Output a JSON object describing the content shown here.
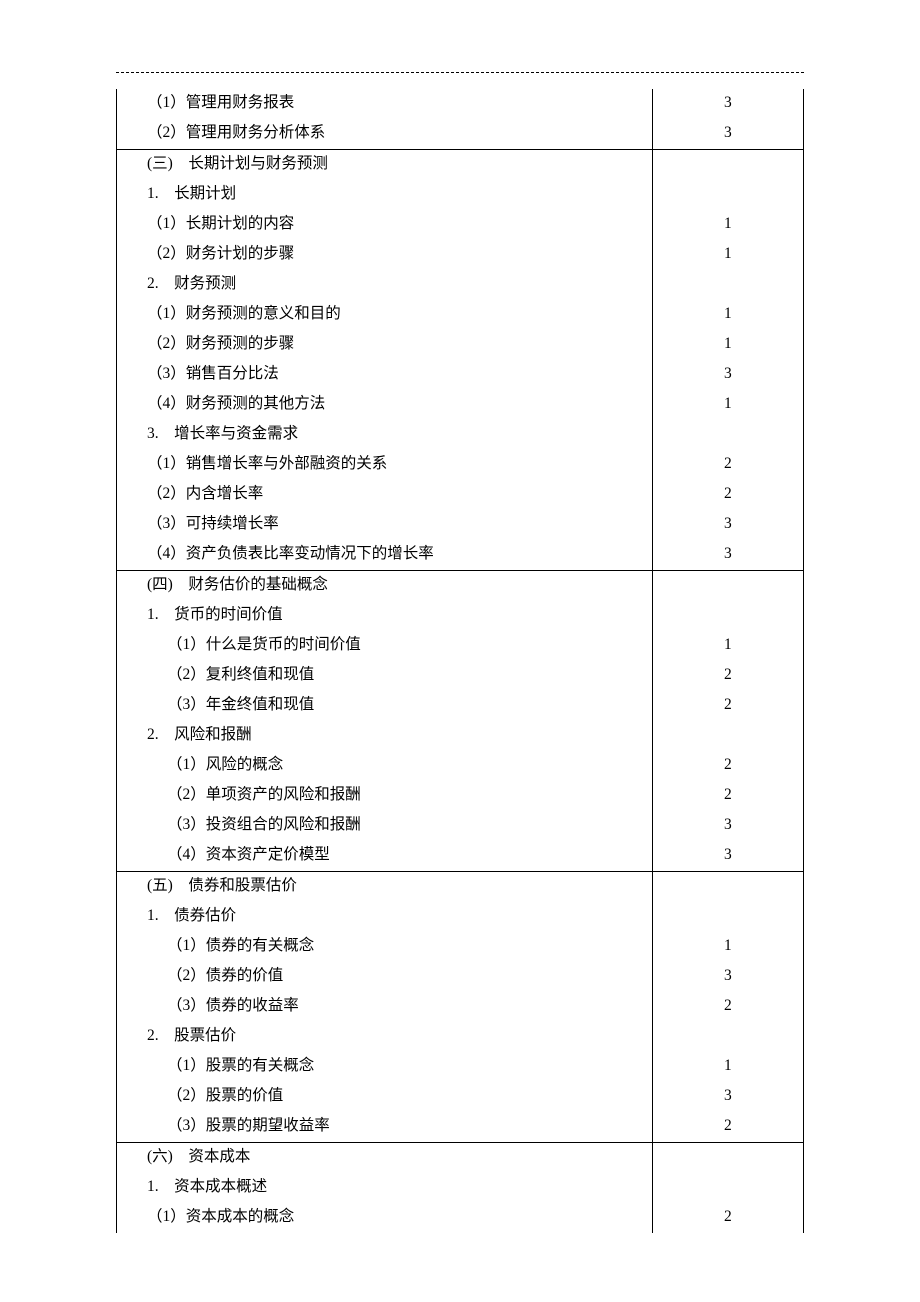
{
  "rows": [
    {
      "sep": false,
      "indent": 0,
      "label": "（1）管理用财务报表",
      "val": "3"
    },
    {
      "sep": false,
      "indent": 0,
      "label": "（2）管理用财务分析体系",
      "val": "3"
    },
    {
      "sep": true,
      "indent": 0,
      "label": "(三)　长期计划与财务预测",
      "val": ""
    },
    {
      "sep": false,
      "indent": 0,
      "label": "1.　长期计划",
      "val": ""
    },
    {
      "sep": false,
      "indent": 0,
      "label": "（1）长期计划的内容",
      "val": "1"
    },
    {
      "sep": false,
      "indent": 0,
      "label": "（2）财务计划的步骤",
      "val": "1"
    },
    {
      "sep": false,
      "indent": 0,
      "label": "2.　财务预测",
      "val": ""
    },
    {
      "sep": false,
      "indent": 0,
      "label": "（1）财务预测的意义和目的",
      "val": "1"
    },
    {
      "sep": false,
      "indent": 0,
      "label": "（2）财务预测的步骤",
      "val": "1"
    },
    {
      "sep": false,
      "indent": 0,
      "label": "（3）销售百分比法",
      "val": "3"
    },
    {
      "sep": false,
      "indent": 0,
      "label": "（4）财务预测的其他方法",
      "val": "1"
    },
    {
      "sep": false,
      "indent": 0,
      "label": "3.　增长率与资金需求",
      "val": ""
    },
    {
      "sep": false,
      "indent": 0,
      "label": "（1）销售增长率与外部融资的关系",
      "val": "2"
    },
    {
      "sep": false,
      "indent": 0,
      "label": "（2）内含增长率",
      "val": "2"
    },
    {
      "sep": false,
      "indent": 0,
      "label": "（3）可持续增长率",
      "val": "3"
    },
    {
      "sep": false,
      "indent": 0,
      "label": "（4）资产负债表比率变动情况下的增长率",
      "val": "3"
    },
    {
      "sep": true,
      "indent": 0,
      "label": "(四)　财务估价的基础概念",
      "val": ""
    },
    {
      "sep": false,
      "indent": 0,
      "label": "1.　货币的时间价值",
      "val": ""
    },
    {
      "sep": false,
      "indent": 1,
      "label": "（1）什么是货币的时间价值",
      "val": "1"
    },
    {
      "sep": false,
      "indent": 1,
      "label": "（2）复利终值和现值",
      "val": "2"
    },
    {
      "sep": false,
      "indent": 1,
      "label": "（3）年金终值和现值",
      "val": "2"
    },
    {
      "sep": false,
      "indent": 0,
      "label": "2.　风险和报酬",
      "val": ""
    },
    {
      "sep": false,
      "indent": 1,
      "label": "（1）风险的概念",
      "val": "2"
    },
    {
      "sep": false,
      "indent": 1,
      "label": "（2）单项资产的风险和报酬",
      "val": "2"
    },
    {
      "sep": false,
      "indent": 1,
      "label": "（3）投资组合的风险和报酬",
      "val": "3"
    },
    {
      "sep": false,
      "indent": 1,
      "label": "（4）资本资产定价模型",
      "val": "3"
    },
    {
      "sep": true,
      "indent": 0,
      "label": "(五)　债券和股票估价",
      "val": ""
    },
    {
      "sep": false,
      "indent": 0,
      "label": "1.　债券估价",
      "val": ""
    },
    {
      "sep": false,
      "indent": 1,
      "label": "（1）债券的有关概念",
      "val": "1"
    },
    {
      "sep": false,
      "indent": 1,
      "label": "（2）债券的价值",
      "val": "3"
    },
    {
      "sep": false,
      "indent": 1,
      "label": "（3）债券的收益率",
      "val": "2"
    },
    {
      "sep": false,
      "indent": 0,
      "label": "2.　股票估价",
      "val": ""
    },
    {
      "sep": false,
      "indent": 1,
      "label": "（1）股票的有关概念",
      "val": "1"
    },
    {
      "sep": false,
      "indent": 1,
      "label": "（2）股票的价值",
      "val": "3"
    },
    {
      "sep": false,
      "indent": 1,
      "label": "（3）股票的期望收益率",
      "val": "2"
    },
    {
      "sep": true,
      "indent": 0,
      "label": "(六)　资本成本",
      "val": ""
    },
    {
      "sep": false,
      "indent": 0,
      "label": "1.　资本成本概述",
      "val": ""
    },
    {
      "sep": false,
      "indent": 0,
      "label": "（1）资本成本的概念",
      "val": "2"
    }
  ]
}
